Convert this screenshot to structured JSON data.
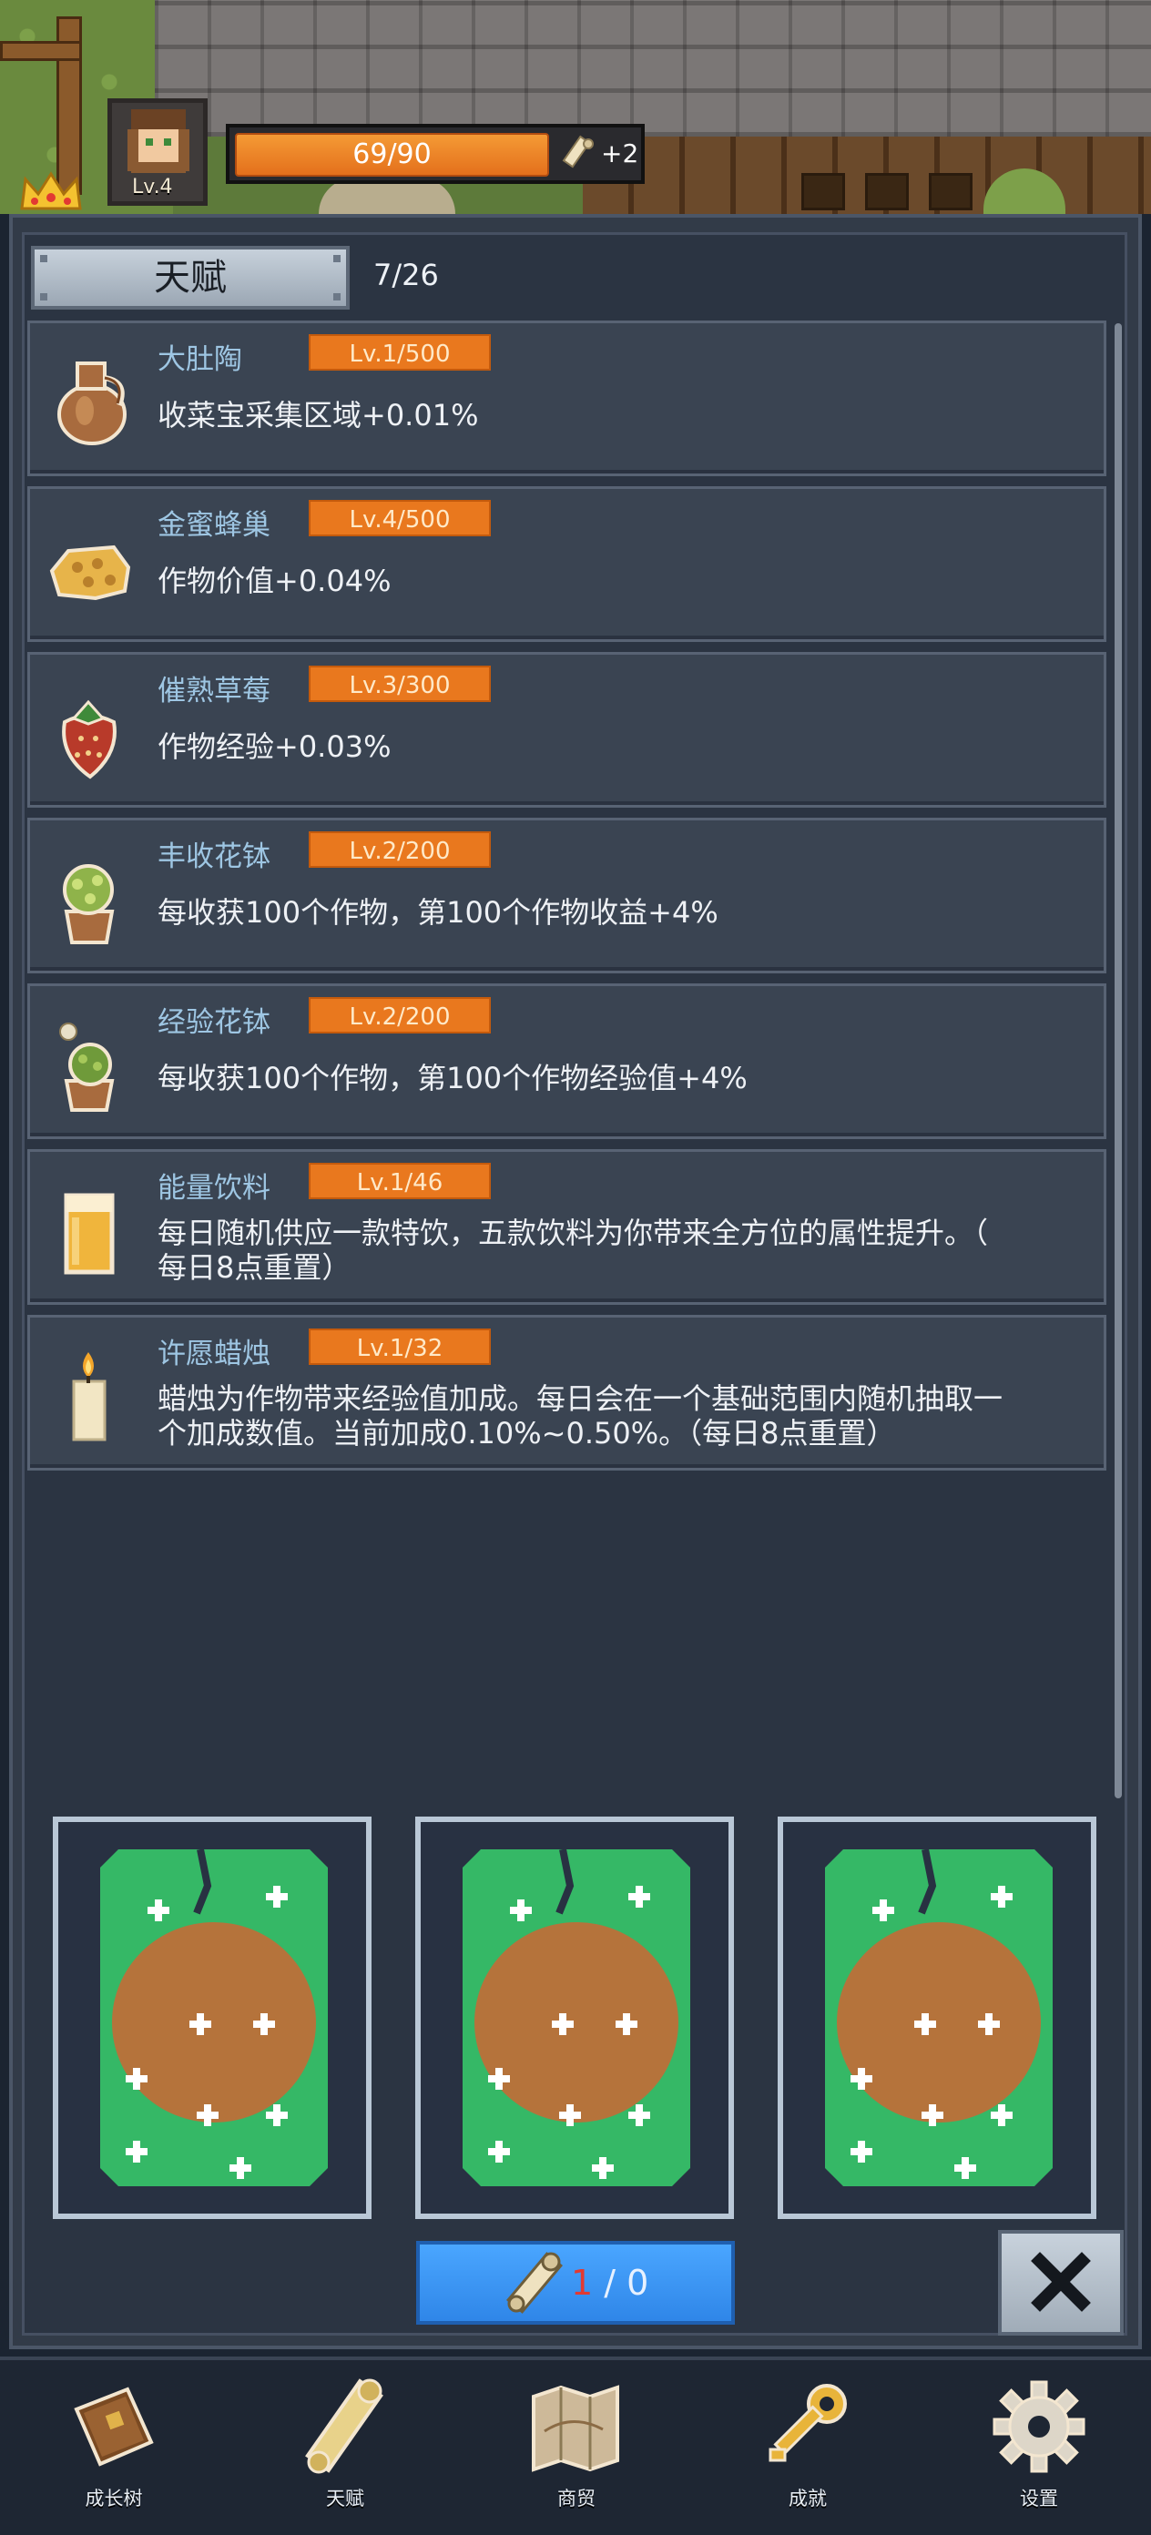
{
  "player": {
    "level": "Lv.4",
    "hp_text": "69/90",
    "hp_fraction": 0.767,
    "bonus": "+2"
  },
  "header": {
    "tab_title": "天赋",
    "count": "7/26"
  },
  "talents": [
    {
      "name": "大肚陶",
      "level": "Lv.1/500",
      "desc": "收菜宝采集区域+0.01%",
      "icon": "clay-jug-icon"
    },
    {
      "name": "金蜜蜂巢",
      "level": "Lv.4/500",
      "desc": "作物价值+0.04%",
      "icon": "honeycomb-icon"
    },
    {
      "name": "催熟草莓",
      "level": "Lv.3/300",
      "desc": "作物经验+0.03%",
      "icon": "strawberry-icon"
    },
    {
      "name": "丰收花钵",
      "level": "Lv.2/200",
      "desc": "每收获100个作物，第100个作物收益+4%",
      "icon": "flower-pot-icon"
    },
    {
      "name": "经验花钵",
      "level": "Lv.2/200",
      "desc": "每收获100个作物，第100个作物经验值+4%",
      "icon": "flower-pot-sparkle-icon"
    },
    {
      "name": "能量饮料",
      "level": "Lv.1/46",
      "desc_line1": "每日随机供应一款特饮，五款饮料为你带来全方位的属性提升。（",
      "desc_line2": "每日8点重置）",
      "icon": "beer-mug-icon"
    },
    {
      "name": "许愿蜡烛",
      "level": "Lv.1/32",
      "desc_line1": "蜡烛为作物带来经验值加成。每日会在一个基础范围内随机抽取一",
      "desc_line2": "个加成数值。当前加成0.10%~0.50%。（每日8点重置）",
      "icon": "candle-icon"
    }
  ],
  "draw": {
    "current": "1",
    "separator": " / ",
    "max": "0"
  },
  "colors": {
    "accent_orange": "#e9781e",
    "card_green": "#35b866",
    "card_brown": "#b5733b",
    "button_blue": "#2f86e8"
  },
  "nav": [
    {
      "label": "成长树",
      "icon": "book-icon"
    },
    {
      "label": "天赋",
      "icon": "scroll-icon"
    },
    {
      "label": "商贸",
      "icon": "map-icon"
    },
    {
      "label": "成就",
      "icon": "key-icon"
    },
    {
      "label": "设置",
      "icon": "gear-icon"
    }
  ]
}
